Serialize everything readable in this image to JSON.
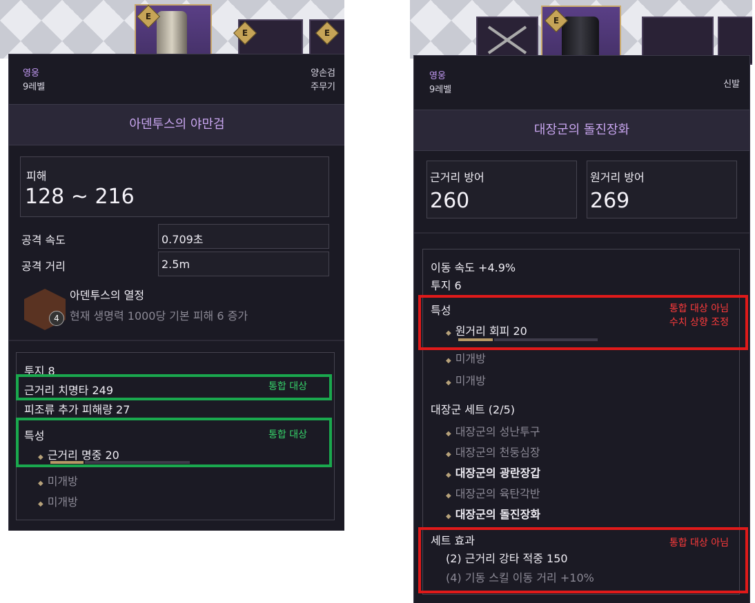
{
  "left": {
    "grade": "영웅",
    "level": "9레벨",
    "item_type": "양손검",
    "slot_type": "주무기",
    "item_level_badge": "9",
    "badge_letter": "E",
    "item_name": "아덴투스의 야만검",
    "damage_label": "피해",
    "damage_value": "128 ~ 216",
    "attack_speed_label": "공격 속도",
    "attack_speed_value": "0.709초",
    "attack_range_label": "공격 거리",
    "attack_range_value": "2.5m",
    "passive_name": "아덴투스의 열정",
    "passive_level": "4",
    "passive_desc": "현재 생명력 1000당 기본 피해 6 증가",
    "stat1": "투지  8",
    "stat2": "근거리 치명타   249",
    "stat3": "피조류 추가 피해량   27",
    "trait_label": "특성",
    "trait1": "근거리 명중 20",
    "locked1": "미개방",
    "locked2": "미개방",
    "annotation1": "통합 대상",
    "annotation2": "통합 대상"
  },
  "right": {
    "grade": "영웅",
    "level": "9레벨",
    "item_type": "신발",
    "item_level_badge": "9",
    "badge_letter": "E",
    "item_name": "대장군의 돌진장화",
    "melee_def_label": "근거리 방어",
    "melee_def_value": "260",
    "ranged_def_label": "원거리 방어",
    "ranged_def_value": "269",
    "stat1": "이동 속도   +4.9%",
    "stat2": "투지   6",
    "trait_label": "특성",
    "trait1": "원거리 회피 20",
    "locked1": "미개방",
    "locked2": "미개방",
    "set_title": "대장군 세트 (2/5)",
    "set_items": [
      "대장군의 성난투구",
      "대장군의 천둥심장",
      "대장군의 광란장갑",
      "대장군의 육탄각반",
      "대장군의 돌진장화"
    ],
    "set_effect_label": "세트 효과",
    "set_effect1": "(2) 근거리 강타 적중 150",
    "set_effect2": "(4) 기동 스킬 이동 거리 +10%",
    "annotation_trait_line1": "통합 대상 아님",
    "annotation_trait_line2": "수치 상향 조정",
    "annotation_set": "통합 대상 아님"
  }
}
